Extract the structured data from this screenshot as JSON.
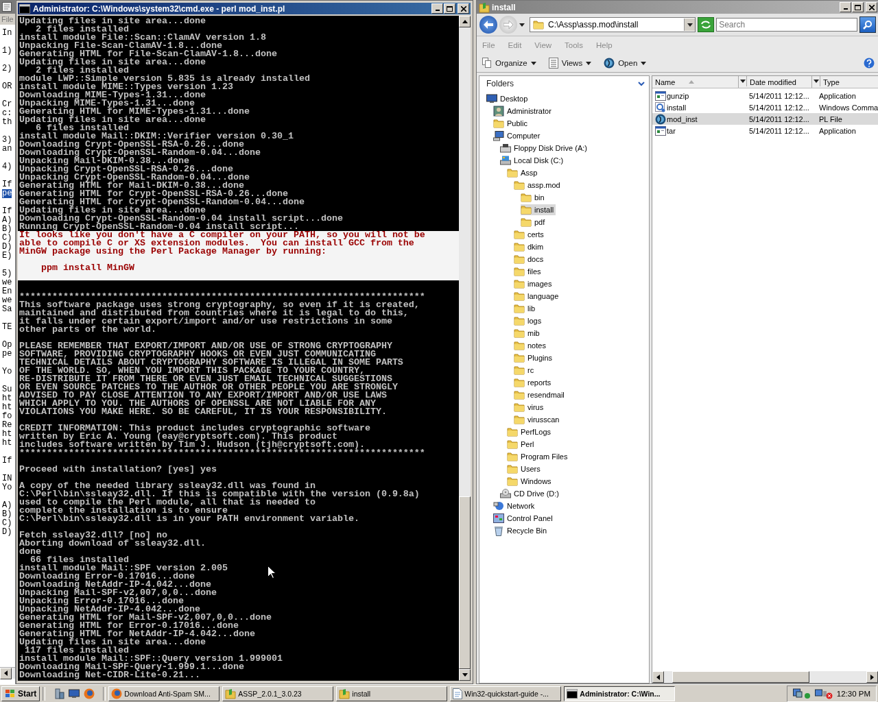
{
  "background_window": {
    "menu": [
      "File"
    ],
    "paragraphs": [
      [
        {
          "text": "In",
          "selected": false
        }
      ],
      [
        {
          "text": "1)",
          "selected": false
        }
      ],
      [
        {
          "text": "2)",
          "selected": false
        }
      ],
      [
        {
          "text": "OR",
          "selected": false
        }
      ],
      [
        {
          "text": "Cr",
          "selected": false
        },
        {
          "text": "c:",
          "selected": false
        },
        {
          "text": "th",
          "selected": false
        }
      ],
      [
        {
          "text": "3)",
          "selected": false
        },
        {
          "text": "an",
          "selected": false
        }
      ],
      [
        {
          "text": "4)",
          "selected": false
        }
      ],
      [
        {
          "text": "If",
          "selected": false
        },
        {
          "text": "pe",
          "selected": true
        }
      ],
      [
        {
          "text": "If",
          "selected": false
        },
        {
          "text": "A)",
          "selected": false
        },
        {
          "text": "B)",
          "selected": false
        },
        {
          "text": "C)",
          "selected": false
        },
        {
          "text": "D)",
          "selected": false
        },
        {
          "text": "E)",
          "selected": false
        }
      ],
      [
        {
          "text": "5)",
          "selected": false
        },
        {
          "text": "we",
          "selected": false
        },
        {
          "text": "En",
          "selected": false
        },
        {
          "text": "we",
          "selected": false
        },
        {
          "text": "Sa",
          "selected": false
        }
      ],
      [
        {
          "text": "TE",
          "selected": false
        }
      ],
      [
        {
          "text": "Op",
          "selected": false
        },
        {
          "text": "pe",
          "selected": false
        }
      ],
      [
        {
          "text": "Yo",
          "selected": false
        }
      ],
      [
        {
          "text": "Su",
          "selected": false
        },
        {
          "text": "ht",
          "selected": false
        },
        {
          "text": "ht",
          "selected": false
        },
        {
          "text": "fo",
          "selected": false
        },
        {
          "text": "Re",
          "selected": false
        },
        {
          "text": "ht",
          "selected": false
        },
        {
          "text": "ht",
          "selected": false
        }
      ],
      [
        {
          "text": "If",
          "selected": false
        }
      ],
      [
        {
          "text": "IN",
          "selected": false
        },
        {
          "text": "Yo",
          "selected": false
        }
      ],
      [
        {
          "text": "A)",
          "selected": false
        },
        {
          "text": "B)",
          "selected": false
        },
        {
          "text": "C)",
          "selected": false
        },
        {
          "text": "D)",
          "selected": false
        }
      ]
    ]
  },
  "console_window": {
    "title": "Administrator: C:\\Windows\\system32\\cmd.exe - perl  mod_inst.pl",
    "blocks": [
      {
        "kind": "normal",
        "paragraphs": [
          [
            "Updating files in site area...done",
            "   2 files installed",
            "install module File::Scan::ClamAV version 1.8",
            "Unpacking File-Scan-ClamAV-1.8...done",
            "Generating HTML for File-Scan-ClamAV-1.8...done",
            "Updating files in site area...done",
            "   2 files installed",
            "module LWP::Simple version 5.835 is already installed",
            "install module MIME::Types version 1.23",
            "Downloading MIME-Types-1.31...done",
            "Unpacking MIME-Types-1.31...done",
            "Generating HTML for MIME-Types-1.31...done",
            "Updating files in site area...done",
            "   6 files installed",
            "install module Mail::DKIM::Verifier version 0.30_1",
            "Downloading Crypt-OpenSSL-RSA-0.26...done",
            "Downloading Crypt-OpenSSL-Random-0.04...done",
            "Unpacking Mail-DKIM-0.38...done",
            "Unpacking Crypt-OpenSSL-RSA-0.26...done",
            "Unpacking Crypt-OpenSSL-Random-0.04...done",
            "Generating HTML for Mail-DKIM-0.38...done",
            "Generating HTML for Crypt-OpenSSL-RSA-0.26...done",
            "Generating HTML for Crypt-OpenSSL-Random-0.04...done",
            "Updating files in site area...done",
            "Downloading Crypt-OpenSSL-Random-0.04 install script...done",
            "Running Crypt-OpenSSL-Random-0.04 install script..."
          ]
        ]
      },
      {
        "kind": "warning",
        "paragraphs": [
          [
            "It looks like you don't have a C compiler on your PATH, so you will not be",
            "able to compile C or XS extension modules.  You can install GCC from the",
            "MinGW package using the Perl Package Manager by running:"
          ],
          [
            "    ppm install MinGW"
          ]
        ]
      },
      {
        "kind": "normal",
        "paragraphs": [
          [
            "**************************************************************************",
            "This software package uses strong cryptography, so even if it is created,",
            "maintained and distributed from countries where it is legal to do this,",
            "it falls under certain export/import and/or use restrictions in some",
            "other parts of the world."
          ],
          [
            "PLEASE REMEMBER THAT EXPORT/IMPORT AND/OR USE OF STRONG CRYPTOGRAPHY",
            "SOFTWARE, PROVIDING CRYPTOGRAPHY HOOKS OR EVEN JUST COMMUNICATING",
            "TECHNICAL DETAILS ABOUT CRYPTOGRAPHY SOFTWARE IS ILLEGAL IN SOME PARTS",
            "OF THE WORLD. SO, WHEN YOU IMPORT THIS PACKAGE TO YOUR COUNTRY,",
            "RE-DISTRIBUTE IT FROM THERE OR EVEN JUST EMAIL TECHNICAL SUGGESTIONS",
            "OR EVEN SOURCE PATCHES TO THE AUTHOR OR OTHER PEOPLE YOU ARE STRONGLY",
            "ADVISED TO PAY CLOSE ATTENTION TO ANY EXPORT/IMPORT AND/OR USE LAWS",
            "WHICH APPLY TO YOU. THE AUTHORS OF OPENSSL ARE NOT LIABLE FOR ANY",
            "VIOLATIONS YOU MAKE HERE. SO BE CAREFUL, IT IS YOUR RESPONSIBILITY."
          ],
          [
            "CREDIT INFORMATION: This product includes cryptographic software",
            "written by Eric A. Young (eay@cryptsoft.com). This product",
            "includes software written by Tim J. Hudson (tjh@cryptsoft.com).",
            "**************************************************************************"
          ],
          [
            "Proceed with installation? [yes] yes"
          ],
          [
            "A copy of the needed library ssleay32.dll was found in",
            "C:\\Perl\\bin\\ssleay32.dll. If this is compatible with the version (0.9.8a)",
            "used to compile the Perl module, all that is needed to",
            "complete the installation is to ensure",
            "C:\\Perl\\bin\\ssleay32.dll is in your PATH environment variable."
          ],
          [
            "Fetch ssleay32.dll? [no] no",
            "Aborting download of ssleay32.dll.",
            "done",
            "  66 files installed",
            "install module Mail::SPF version 2.005",
            "Downloading Error-0.17016...done",
            "Downloading NetAddr-IP-4.042...done",
            "Unpacking Mail-SPF-v2,007,0,0...done",
            "Unpacking Error-0.17016...done",
            "Unpacking NetAddr-IP-4.042...done",
            "Generating HTML for Mail-SPF-v2,007,0,0...done",
            "Generating HTML for Error-0.17016...done",
            "Generating HTML for NetAddr-IP-4.042...done",
            "Updating files in site area...done",
            " 117 files installed",
            "install module Mail::SPF::Query version 1.999001",
            "Downloading Mail-SPF-Query-1.999.1...done",
            "Downloading Net-CIDR-Lite-0.21..."
          ]
        ]
      }
    ]
  },
  "explorer": {
    "title": "install",
    "address": "C:\\Assp\\assp.mod\\install",
    "search": {
      "placeholder": "Search"
    },
    "menu": [
      "File",
      "Edit",
      "View",
      "Tools",
      "Help"
    ],
    "toolbar": [
      {
        "label": "Organize",
        "kind": "organize"
      },
      {
        "label": "Views",
        "kind": "views"
      },
      {
        "label": "Open",
        "kind": "open"
      }
    ],
    "folders_title": "Folders",
    "tree": [
      {
        "label": "Desktop",
        "kind": "desktop",
        "selected": false,
        "children": [
          {
            "label": "Administrator",
            "kind": "user",
            "selected": false
          },
          {
            "label": "Public",
            "kind": "folder",
            "selected": false
          },
          {
            "label": "Computer",
            "kind": "computer",
            "selected": false,
            "children": [
              {
                "label": "Floppy Disk Drive (A:)",
                "kind": "floppy",
                "selected": false
              },
              {
                "label": "Local Disk (C:)",
                "kind": "disk",
                "selected": false,
                "children": [
                  {
                    "label": "Assp",
                    "kind": "folder",
                    "selected": false,
                    "children": [
                      {
                        "label": "assp.mod",
                        "kind": "folder",
                        "selected": false,
                        "children": [
                          {
                            "label": "bin",
                            "kind": "folder",
                            "selected": false
                          },
                          {
                            "label": "install",
                            "kind": "folder",
                            "selected": true
                          },
                          {
                            "label": "pdf",
                            "kind": "folder",
                            "selected": false
                          }
                        ]
                      },
                      {
                        "label": "certs",
                        "kind": "folder",
                        "selected": false
                      },
                      {
                        "label": "dkim",
                        "kind": "folder",
                        "selected": false
                      },
                      {
                        "label": "docs",
                        "kind": "folder",
                        "selected": false
                      },
                      {
                        "label": "files",
                        "kind": "folder",
                        "selected": false
                      },
                      {
                        "label": "images",
                        "kind": "folder",
                        "selected": false
                      },
                      {
                        "label": "language",
                        "kind": "folder",
                        "selected": false
                      },
                      {
                        "label": "lib",
                        "kind": "folder",
                        "selected": false
                      },
                      {
                        "label": "logs",
                        "kind": "folder",
                        "selected": false
                      },
                      {
                        "label": "mib",
                        "kind": "folder",
                        "selected": false
                      },
                      {
                        "label": "notes",
                        "kind": "folder",
                        "selected": false
                      },
                      {
                        "label": "Plugins",
                        "kind": "folder",
                        "selected": false
                      },
                      {
                        "label": "rc",
                        "kind": "folder",
                        "selected": false
                      },
                      {
                        "label": "reports",
                        "kind": "folder",
                        "selected": false
                      },
                      {
                        "label": "resendmail",
                        "kind": "folder",
                        "selected": false
                      },
                      {
                        "label": "virus",
                        "kind": "folder",
                        "selected": false
                      },
                      {
                        "label": "virusscan",
                        "kind": "folder",
                        "selected": false
                      }
                    ]
                  },
                  {
                    "label": "PerfLogs",
                    "kind": "folder",
                    "selected": false
                  },
                  {
                    "label": "Perl",
                    "kind": "folder",
                    "selected": false
                  },
                  {
                    "label": "Program Files",
                    "kind": "folder",
                    "selected": false
                  },
                  {
                    "label": "Users",
                    "kind": "folder",
                    "selected": false
                  },
                  {
                    "label": "Windows",
                    "kind": "folder",
                    "selected": false
                  }
                ]
              },
              {
                "label": "CD Drive (D:)",
                "kind": "cd",
                "selected": false
              }
            ]
          },
          {
            "label": "Network",
            "kind": "network",
            "selected": false
          },
          {
            "label": "Control Panel",
            "kind": "control-panel",
            "selected": false
          },
          {
            "label": "Recycle Bin",
            "kind": "recycle-bin",
            "selected": false
          }
        ]
      }
    ],
    "columns": [
      "Name",
      "Date modified",
      "Type"
    ],
    "files": [
      {
        "name": "gunzip",
        "date": "5/14/2011 12:12...",
        "type": "Application",
        "kind": "application",
        "selected": false
      },
      {
        "name": "install",
        "date": "5/14/2011 12:12...",
        "type": "Windows Comma",
        "kind": "script",
        "selected": false
      },
      {
        "name": "mod_inst",
        "date": "5/14/2011 12:12...",
        "type": "PL File",
        "kind": "perl",
        "selected": true
      },
      {
        "name": "tar",
        "date": "5/14/2011 12:12...",
        "type": "Application",
        "kind": "application",
        "selected": false
      }
    ]
  },
  "taskbar": {
    "start": "Start",
    "tasks": [
      {
        "label": "Download Anti-Spam SM...",
        "kind": "browser",
        "selected": false
      },
      {
        "label": "ASSP_2.0.1_3.0.23",
        "kind": "folder",
        "selected": false
      },
      {
        "label": "install",
        "kind": "folder",
        "selected": false
      },
      {
        "label": "Win32-quickstart-guide -...",
        "kind": "document",
        "selected": false
      },
      {
        "label": "Administrator: C:\\Win...",
        "kind": "console",
        "selected": true
      }
    ],
    "clock": "12:30 PM"
  }
}
